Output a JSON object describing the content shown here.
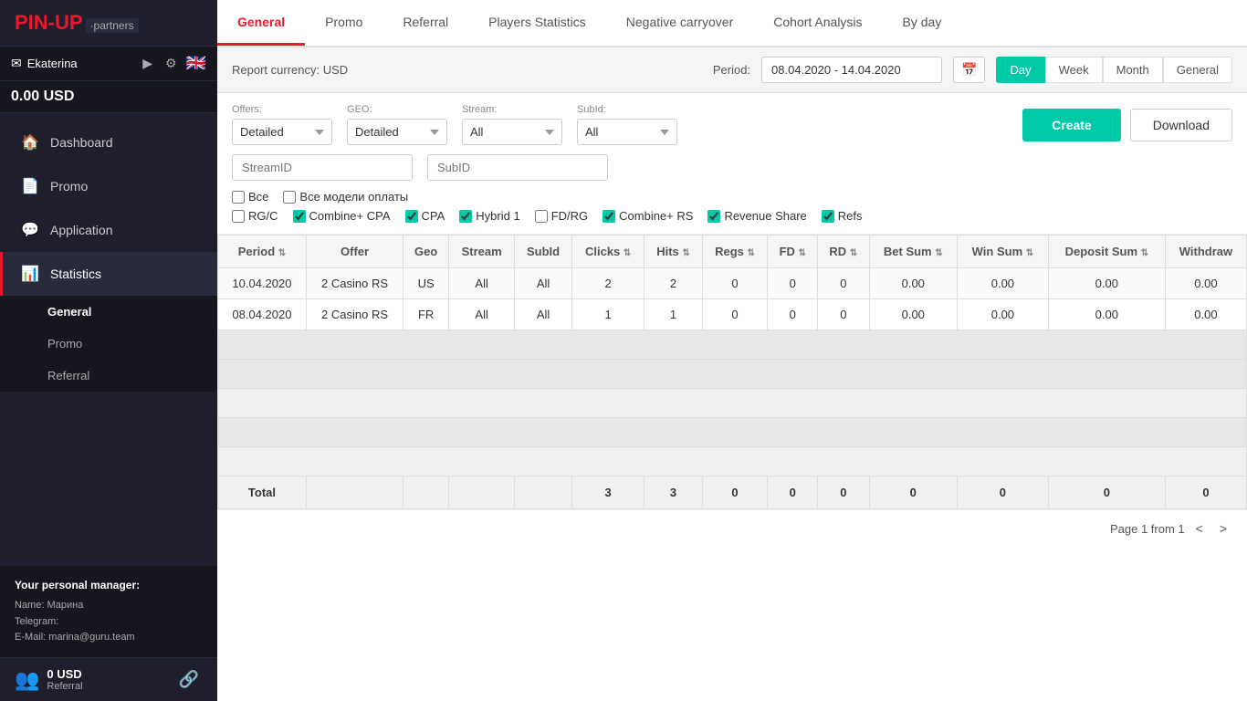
{
  "logo": {
    "main": "PIN-UP",
    "sub": "·partners"
  },
  "user": {
    "name": "Ekaterina",
    "balance": "0.00 USD"
  },
  "nav": {
    "items": [
      {
        "id": "dashboard",
        "label": "Dashboard",
        "icon": "🏠"
      },
      {
        "id": "promo",
        "label": "Promo",
        "icon": "📄"
      },
      {
        "id": "application",
        "label": "Application",
        "icon": "💬"
      },
      {
        "id": "statistics",
        "label": "Statistics",
        "icon": "📊",
        "active": true
      }
    ],
    "sub_items": [
      {
        "id": "general",
        "label": "General",
        "active": true
      },
      {
        "id": "promo-sub",
        "label": "Promo"
      },
      {
        "id": "referral",
        "label": "Referral"
      }
    ]
  },
  "manager": {
    "title": "Your personal manager:",
    "name": "Name: Марина",
    "telegram": "Telegram:",
    "email": "E-Mail: marina@guru.team"
  },
  "bottom": {
    "amount": "0 USD",
    "label": "Referral"
  },
  "top_tabs": [
    {
      "id": "general",
      "label": "General",
      "active": true
    },
    {
      "id": "promo",
      "label": "Promo"
    },
    {
      "id": "referral",
      "label": "Referral"
    },
    {
      "id": "players-stats",
      "label": "Players Statistics"
    },
    {
      "id": "negative-carryover",
      "label": "Negative carryover"
    },
    {
      "id": "cohort-analysis",
      "label": "Cohort Analysis"
    },
    {
      "id": "by-day",
      "label": "By day"
    }
  ],
  "report": {
    "currency_label": "Report currency: USD",
    "period_label": "Period:",
    "period_value": "08.04.2020 - 14.04.2020",
    "period_tabs": [
      {
        "id": "day",
        "label": "Day",
        "active": true
      },
      {
        "id": "week",
        "label": "Week"
      },
      {
        "id": "month",
        "label": "Month"
      },
      {
        "id": "general",
        "label": "General"
      }
    ]
  },
  "filters": {
    "offers_label": "Offers:",
    "offers_value": "Detailed",
    "geo_label": "GEO:",
    "geo_value": "Detailed",
    "stream_label": "Stream:",
    "stream_value": "All",
    "subid_label": "SubId:",
    "subid_value": "All",
    "streamid_placeholder": "StreamID",
    "subid_placeholder": "SubID",
    "btn_create": "Create",
    "btn_download": "Download"
  },
  "checkboxes": {
    "vse_label": "Все",
    "vse_all_label": "Все модели оплаты",
    "items": [
      {
        "id": "rgc",
        "label": "RG/C",
        "checked": false
      },
      {
        "id": "combine_cpa",
        "label": "Combine+ CPA",
        "checked": true
      },
      {
        "id": "cpa",
        "label": "CPA",
        "checked": true
      },
      {
        "id": "hybrid1",
        "label": "Hybrid 1",
        "checked": true
      },
      {
        "id": "fd_rg",
        "label": "FD/RG",
        "checked": false
      },
      {
        "id": "combine_rs",
        "label": "Combine+ RS",
        "checked": true
      },
      {
        "id": "revenue_share",
        "label": "Revenue Share",
        "checked": true
      },
      {
        "id": "refs",
        "label": "Refs",
        "checked": true
      }
    ]
  },
  "table": {
    "headers": [
      "Period",
      "Offer",
      "Geo",
      "Stream",
      "SubId",
      "Clicks",
      "Hits",
      "Regs",
      "FD",
      "RD",
      "Bet Sum",
      "Win Sum",
      "Deposit Sum",
      "Withdraw"
    ],
    "rows": [
      {
        "period": "10.04.2020",
        "offer": "2 Casino RS",
        "geo": "US",
        "stream": "All",
        "subid": "All",
        "clicks": "2",
        "hits": "2",
        "regs": "0",
        "fd": "0",
        "rd": "0",
        "bet_sum": "0.00",
        "win_sum": "0.00",
        "deposit_sum": "0.00",
        "withdraw": "0.00"
      },
      {
        "period": "08.04.2020",
        "offer": "2 Casino RS",
        "geo": "FR",
        "stream": "All",
        "subid": "All",
        "clicks": "1",
        "hits": "1",
        "regs": "0",
        "fd": "0",
        "rd": "0",
        "bet_sum": "0.00",
        "win_sum": "0.00",
        "deposit_sum": "0.00",
        "withdraw": "0.00"
      }
    ],
    "empty_rows": 5,
    "total": {
      "label": "Total",
      "clicks": "3",
      "hits": "3",
      "regs": "0",
      "fd": "0",
      "rd": "0",
      "bet_sum": "0",
      "win_sum": "0",
      "deposit_sum": "0",
      "withdraw": "0"
    }
  },
  "pagination": {
    "text": "Page 1 from 1"
  }
}
